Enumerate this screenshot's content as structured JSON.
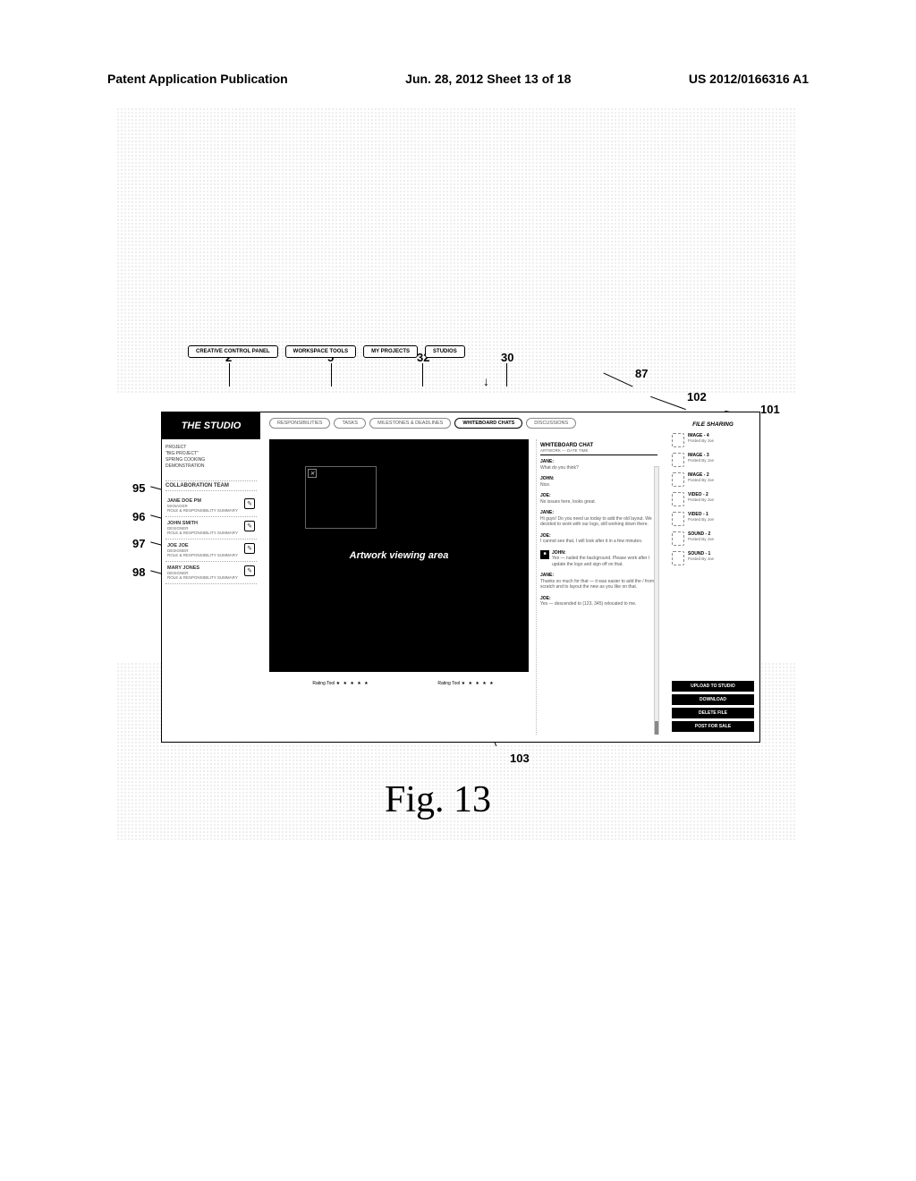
{
  "header": {
    "left": "Patent Application Publication",
    "center": "Jun. 28, 2012  Sheet 13 of 18",
    "right": "US 2012/0166316 A1"
  },
  "callouts": {
    "n2": "2",
    "n5": "5",
    "n32": "32",
    "n30": "30",
    "n87": "87",
    "n101": "101",
    "n102": "102",
    "n103": "103",
    "n95": "95",
    "n96": "96",
    "n97": "97",
    "n98": "98"
  },
  "nav": {
    "pill1": "CREATIVE CONTROL PANEL",
    "pill2": "WORKSPACE TOOLS",
    "pill3": "MY PROJECTS",
    "pill4": "STUDIOS"
  },
  "studio_title": "THE STUDIO",
  "sub_tabs": {
    "t1": "RESPONSIBILITIES",
    "t2": "TASKS",
    "t3": "MILESTONES & DEADLINES",
    "t4": "WHITEBOARD CHATS",
    "t5": "DISCUSSIONS"
  },
  "left": {
    "proj1": "PROJECT",
    "proj2": "\"BIG PROJECT\"",
    "proj3": "SPRING COOKING",
    "proj4": "DEMONSTRATION",
    "collab_title": "COLLABORATION TEAM",
    "members": [
      {
        "name": "JANE DOE PM",
        "role": "MANAGER",
        "role2": "ROLE & RESPONSIBILITY SUMMARY"
      },
      {
        "name": "JOHN SMITH",
        "role": "DESIGNER",
        "role2": "ROLE & RESPONSIBILITY SUMMARY"
      },
      {
        "name": "JOE JOE",
        "role": "DESIGNER",
        "role2": "ROLE & RESPONSIBILITY SUMMARY"
      },
      {
        "name": "MARY JONES",
        "role": "DESIGNER",
        "role2": "ROLE & RESPONSIBILITY SUMMARY"
      }
    ]
  },
  "artwork_label": "Artwork viewing area",
  "ratings": {
    "left_label": "Rating Tool",
    "right_label": "Rating Tool",
    "stars": "★ ★ ★ ★ ★"
  },
  "chat": {
    "title": "WHITEBOARD CHAT",
    "sub": "ARTWORK  —  DATE    TIME",
    "msgs": [
      {
        "name": "JANE:",
        "text": "What do you think?"
      },
      {
        "name": "JOHN:",
        "text": "Nice."
      },
      {
        "name": "JOE:",
        "text": "No issues here, looks great."
      },
      {
        "name": "JANE:",
        "text": "Hi guys! Do you need us today to add the old layout. We decided to work with our logo, still working down there."
      },
      {
        "name": "JOE:",
        "text": "I cannot see that, I will look after it in a few minutes."
      },
      {
        "name": "JOHN:",
        "text": "Yes — nailed the background. Please work after I update the logo and sign off on that."
      },
      {
        "name": "JANE:",
        "text": "Thanks so much for that — it was easier to add the / from scratch and to layout the new as you like on that."
      },
      {
        "name": "JOE:",
        "text": "Yes — descended to (123, 345) relocated to me."
      }
    ]
  },
  "files": {
    "title": "FILE SHARING",
    "items": [
      {
        "name": "IMAGE - 4",
        "meta": "Posted By\nJoe"
      },
      {
        "name": "IMAGE - 3",
        "meta": "Posted By\nJoe"
      },
      {
        "name": "IMAGE - 2",
        "meta": "Posted By\nJoe"
      },
      {
        "name": "VIDEO - 2",
        "meta": "Posted By\nJoe"
      },
      {
        "name": "VIDEO - 1",
        "meta": "Posted By\nJoe"
      },
      {
        "name": "SOUND - 2",
        "meta": "Posted By\nJoe"
      },
      {
        "name": "SOUND - 1",
        "meta": "Posted By\nJoe"
      }
    ],
    "actions": {
      "a1": "UPLOAD TO STUDIO",
      "a2": "DOWNLOAD",
      "a3": "DELETE FILE",
      "a4": "POST FOR SALE"
    }
  },
  "figure_caption": "Fig. 13"
}
